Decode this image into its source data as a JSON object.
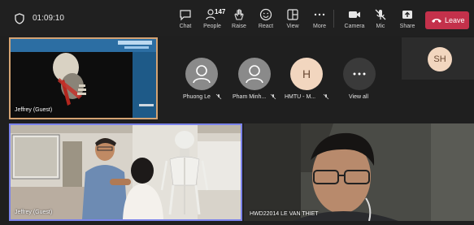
{
  "call": {
    "timer": "01:09:10"
  },
  "toolbar": {
    "chat": "Chat",
    "people": "People",
    "people_count": "147",
    "raise": "Raise",
    "react": "React",
    "view": "View",
    "more": "More",
    "camera": "Camera",
    "mic": "Mic",
    "share": "Share",
    "leave": "Leave"
  },
  "participants_row": [
    {
      "name": "Phuong Le",
      "initials": ""
    },
    {
      "name": "Pham Minh...",
      "initials": ""
    },
    {
      "name": "HMTU - M...",
      "initials": "H"
    },
    {
      "name": "View all",
      "initials": ""
    }
  ],
  "self_tile": {
    "initials": "SH"
  },
  "video_tiles": {
    "shared_screen_name": "Jeffrey (Guest)",
    "main_left_name": "Jeffrey (Guest)",
    "main_right_name": "HWD22014   LE   VAN THIET"
  },
  "colors": {
    "leave_red": "#c4314b",
    "avatar_gray": "#8a8a8a",
    "avatar_peach": "#f2d6bf",
    "active_border": "#7b83eb",
    "shared_border": "#d4a373"
  }
}
